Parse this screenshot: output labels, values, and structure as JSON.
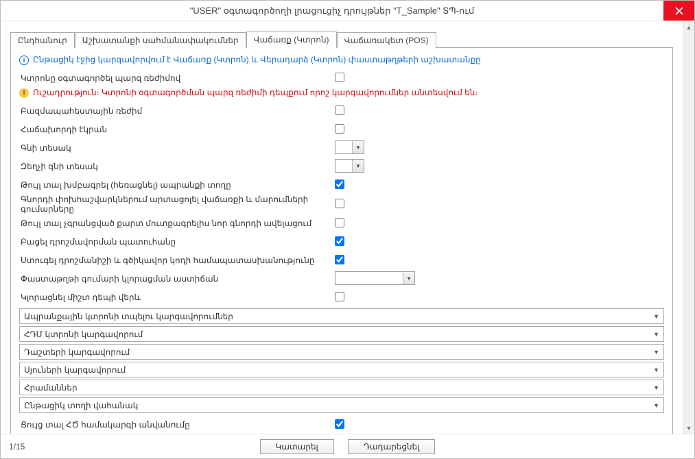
{
  "window": {
    "title": "\"USER\" օգտագործողի լրացուցիչ դրույթներ \"T_Sample\" ՏՊ-ում"
  },
  "tabs": {
    "items": [
      {
        "label": "Ընդհանուր"
      },
      {
        "label": "Աշխատանքի սահմանափակումներ"
      },
      {
        "label": "Վաճառք (Կտրոն)"
      },
      {
        "label": "Վաճառակետ (POS)"
      }
    ],
    "active_index": 2
  },
  "panel": {
    "info_text": "Ընթացիկ էջից կարգավորվում է Վաճառք (Կտրոն) և Վերադարձ (Կտրոն) փաստաթղթերի աշխատանքը",
    "warn_text": "Ուշադրություն։ Կտրոնի օգտագործման պարզ ռեժիմի դեպքում որոշ կարգավորումներ անտեսվում են։",
    "rows": {
      "simple_mode": {
        "label": "Կտրոնը օգտագործել պարզ ռեժիմով"
      },
      "multi_store": {
        "label": "Բազմապահեստային ռեժիմ"
      },
      "customer_screen": {
        "label": "Հաճախորդի էկրան"
      },
      "price_type": {
        "label": "Գնի տեսակ"
      },
      "discount_price_type": {
        "label": "Զեղչի գնի տեսակ"
      },
      "allow_group_del": {
        "label": "Թույլ տալ խմբագրել (հեռացնել) ապրանքի տողը"
      },
      "reflect_amounts": {
        "label": "Գնորդի փոխհաշվարկներում արտացոլել վաճառքի և մարումների գումարները"
      },
      "allow_unreg_card": {
        "label": "Թույլ տալ չգրանցված քարտ մուտքագրելիս նոր գնորդի ավելացում"
      },
      "open_stamp_window": {
        "label": "Բացել դրոշմավորման պատուհանը"
      },
      "check_stamp_code": {
        "label": "Ստուգել դրոշմանիշի և գծիկավոր կոդի համապատասխանությունը"
      },
      "doc_round_star": {
        "label": "Փաստաթղթի գումարի կլորացման աստիճան"
      },
      "round_always_up": {
        "label": "Կլորացնել միշտ դեպի վերև"
      },
      "show_system_name": {
        "label": "Ցույց տալ ՀԾ համակարգի անվանումը"
      }
    },
    "groups": [
      {
        "label": "Ապրանքային կտրոնի տպելու կարգավորումներ"
      },
      {
        "label": "ՀԴՄ կտրոնի կարգավորում"
      },
      {
        "label": "Դաշտերի կարգավորում"
      },
      {
        "label": "Սյուների կարգավորում"
      },
      {
        "label": "Հրամաններ"
      },
      {
        "label": "Ընթացիկ տողի վահանակ"
      }
    ]
  },
  "footer": {
    "pager": "1/15",
    "ok_label": "Կատարել",
    "cancel_label": "Դադարեցնել"
  }
}
